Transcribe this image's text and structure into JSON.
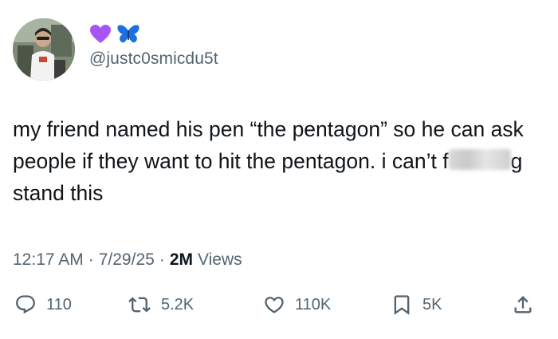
{
  "author": {
    "emojis": [
      "purple-heart",
      "butterfly"
    ],
    "handle": "@justc0smicdu5t"
  },
  "tweet": {
    "text_before": "my friend named his pen “the pentagon” so he can ask people if they want to hit the pentagon. i can’t f",
    "censored_word": "ucki",
    "text_after": "g stand this"
  },
  "meta": {
    "time": "12:17 AM",
    "separator": "·",
    "date": "7/29/25",
    "views_count": "2M",
    "views_label": "Views"
  },
  "actions": {
    "reply_count": "110",
    "retweet_count": "5.2K",
    "like_count": "110K",
    "bookmark_count": "5K"
  },
  "colors": {
    "text": "#0f1419",
    "muted": "#536471",
    "heart_emoji": "#a855f7",
    "butterfly_emoji": "#1d6fe0"
  }
}
